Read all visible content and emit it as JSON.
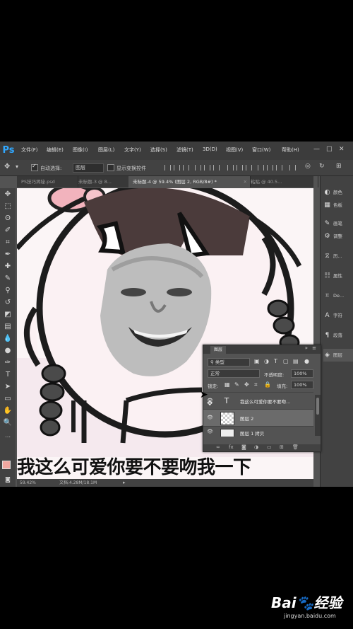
{
  "menu": {
    "logo": "Ps",
    "items": [
      "文件(F)",
      "编辑(E)",
      "图像(I)",
      "图层(L)",
      "文字(Y)",
      "选择(S)",
      "滤镜(T)",
      "3D(D)",
      "视图(V)",
      "窗口(W)",
      "帮助(H)"
    ],
    "win_min": "—",
    "win_max": "□",
    "win_close": "✕"
  },
  "options": {
    "auto_select_label": "自动选择:",
    "auto_select_value": "图层",
    "show_transform_label": "显示变换控件"
  },
  "tabs": [
    {
      "label": "PS技巧揭秘.psd",
      "active": false
    },
    {
      "label": "未标题-3 @ 8...",
      "active": false
    },
    {
      "label": "未标题-4 @ 59.4% (图层 2, RGB/8#) *",
      "active": true
    },
    {
      "label": "粘贴 @ 40.5...",
      "active": false
    }
  ],
  "canvas": {
    "caption": "我这么可爱你要不要吻我一下",
    "skin_color": "#f0a7a0"
  },
  "status": {
    "zoom": "59.42%",
    "doc": "文档:4.28M/18.1M"
  },
  "dock": {
    "items": [
      {
        "icon": "palette-icon",
        "glyph": "◐",
        "label": "颜色"
      },
      {
        "icon": "swatches-icon",
        "glyph": "▦",
        "label": "色板"
      },
      {
        "icon": "brush-icon",
        "glyph": "✎",
        "label": "画笔"
      },
      {
        "icon": "adjust-icon",
        "glyph": "⚙",
        "label": "调整"
      },
      {
        "icon": "history-icon",
        "glyph": "⧖",
        "label": "历..."
      },
      {
        "icon": "properties-icon",
        "glyph": "☷",
        "label": "属性"
      },
      {
        "icon": "device-icon",
        "glyph": "⌗",
        "label": "De..."
      },
      {
        "icon": "char-icon",
        "glyph": "A",
        "label": "字符"
      },
      {
        "icon": "para-icon",
        "glyph": "¶",
        "label": "段落"
      },
      {
        "icon": "layers-icon",
        "glyph": "◈",
        "label": "图层"
      }
    ]
  },
  "layers_panel": {
    "title": "图层",
    "filter_label": "类型",
    "blend_mode": "正常",
    "opacity_label": "不透明度:",
    "opacity_value": "100%",
    "lock_label": "锁定:",
    "fill_label": "填充:",
    "fill_value": "100%",
    "layers": [
      {
        "name": "我这么可爱你要不要吻...",
        "type": "text",
        "selected": false
      },
      {
        "name": "图层 2",
        "type": "pixel",
        "selected": true
      },
      {
        "name": "图层 1 拷贝",
        "type": "pixel",
        "selected": false
      }
    ],
    "footer_fx": "fx"
  },
  "watermark": {
    "logo": "Bai🐾经验",
    "url": "jingyan.baidu.com"
  }
}
